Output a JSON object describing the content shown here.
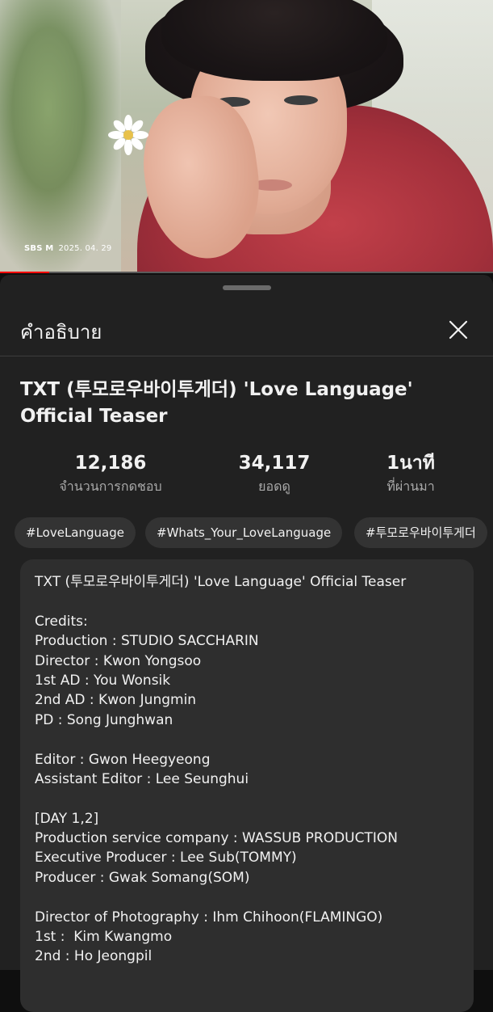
{
  "player": {
    "watermark_logo": "SBS M",
    "watermark_date": "2025. 04. 29",
    "progress_percent": 10
  },
  "sheet": {
    "title": "คำอธิบาย",
    "close_icon": "close-icon"
  },
  "video": {
    "title": "TXT (투모로우바이투게더) 'Love Language' Official Teaser"
  },
  "stats": {
    "likes_value": "12,186",
    "likes_label": "จำนวนการกดชอบ",
    "views_value": "34,117",
    "views_label": "ยอดดู",
    "age_value": "1นาที",
    "age_label": "ที่ผ่านมา"
  },
  "tags": [
    "#LoveLanguage",
    "#Whats_Your_LoveLanguage",
    "#투모로우바이투게더"
  ],
  "description": {
    "lines": [
      "TXT (투모로우바이투게더) 'Love Language' Official Teaser",
      "",
      "Credits:",
      "Production : STUDIO SACCHARIN",
      "Director : Kwon Yongsoo",
      "1st AD : You Wonsik",
      "2nd AD : Kwon Jungmin",
      "PD : Song Junghwan",
      "",
      "Editor : Gwon Heegyeong",
      "Assistant Editor : Lee Seunghui",
      "",
      "[DAY 1,2]",
      "Production service company : WASSUB PRODUCTION",
      "Executive Producer : Lee Sub(TOMMY)",
      "Producer : Gwak Somang(SOM)",
      "",
      "Director of Photography : Ihm Chihoon(FLAMINGO)",
      "1st :  Kim Kwangmo",
      "2nd : Ho Jeongpil"
    ]
  },
  "colors": {
    "sheet_bg": "#212121",
    "chip_bg": "#333333",
    "desc_bg": "#2e2e2e",
    "progress": "#ff0000"
  }
}
